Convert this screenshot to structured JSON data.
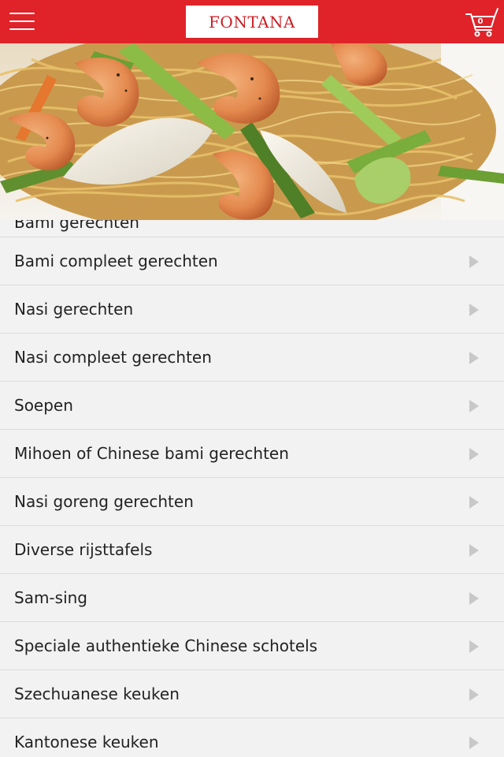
{
  "header": {
    "menu_icon": "hamburger-menu-icon",
    "logo_text": "FONTANA",
    "cart_icon": "shopping-cart-icon",
    "cart_count": "0",
    "brand_color": "#df2329"
  },
  "banner": {
    "image": "noodle-dish-photo"
  },
  "menu": {
    "partial_item_label": "Bami gerechten",
    "items": [
      {
        "label": "Bami compleet gerechten"
      },
      {
        "label": "Nasi gerechten"
      },
      {
        "label": "Nasi compleet gerechten"
      },
      {
        "label": "Soepen"
      },
      {
        "label": "Mihoen of Chinese bami gerechten"
      },
      {
        "label": "Nasi goreng gerechten"
      },
      {
        "label": "Diverse rijsttafels"
      },
      {
        "label": "Sam-sing"
      },
      {
        "label": "Speciale authentieke Chinese schotels"
      },
      {
        "label": "Szechuanese keuken"
      },
      {
        "label": "Kantonese keuken"
      }
    ],
    "arrow_icon": "chevron-right-icon"
  }
}
